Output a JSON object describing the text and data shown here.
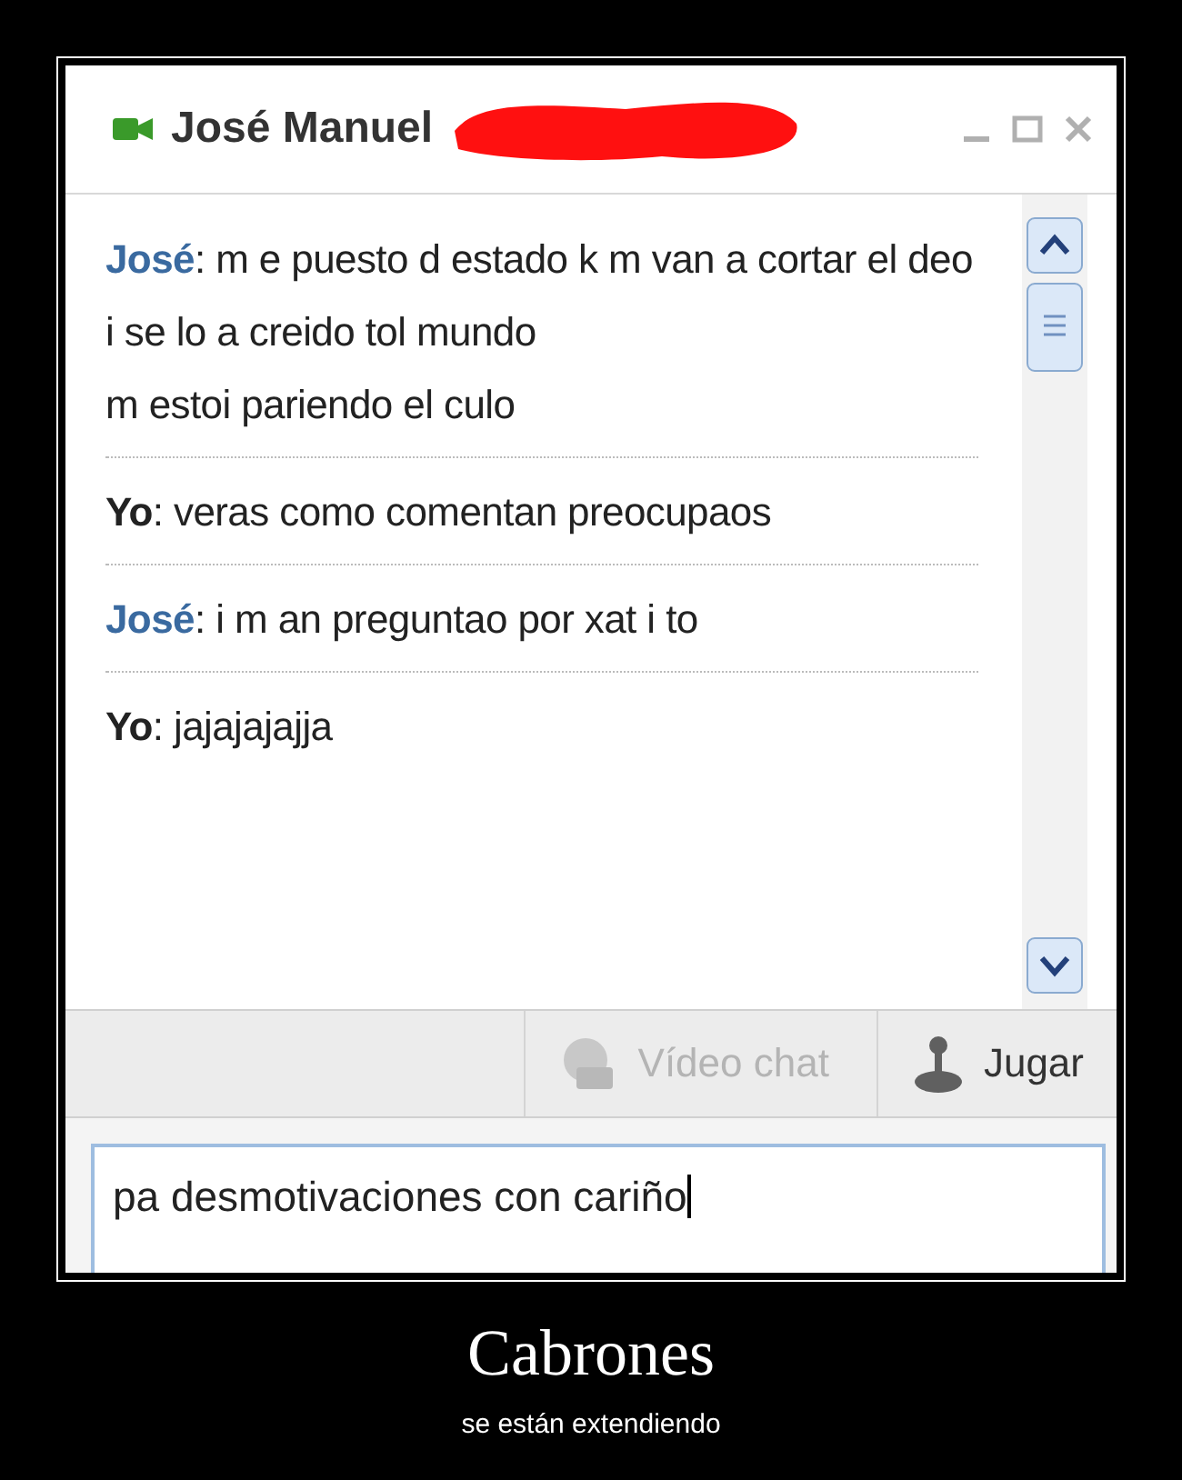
{
  "window": {
    "title": "José Manuel",
    "redacted": true
  },
  "messages": [
    {
      "kind": "contact",
      "lines": [
        "**José**: m e puesto d estado k m van a cortar el deo",
        "i se lo a creido tol mundo",
        "m estoi pariendo el culo"
      ]
    },
    {
      "kind": "self",
      "lines": [
        "**Yo**: veras como comentan preocupaos"
      ]
    },
    {
      "kind": "contact",
      "lines": [
        "**José**: i m an preguntao por xat i to"
      ]
    },
    {
      "kind": "self",
      "lines": [
        "**Yo**: jajajajajja"
      ]
    }
  ],
  "toolbar": [
    {
      "kind": "video",
      "label": "Vídeo chat",
      "disabled": true
    },
    {
      "kind": "game",
      "label": "Jugar",
      "disabled": false
    }
  ],
  "compose": {
    "value": "pa desmotivaciones con cariño"
  },
  "poster": {
    "title": "Cabrones",
    "subtitle": "se están extendiendo"
  }
}
